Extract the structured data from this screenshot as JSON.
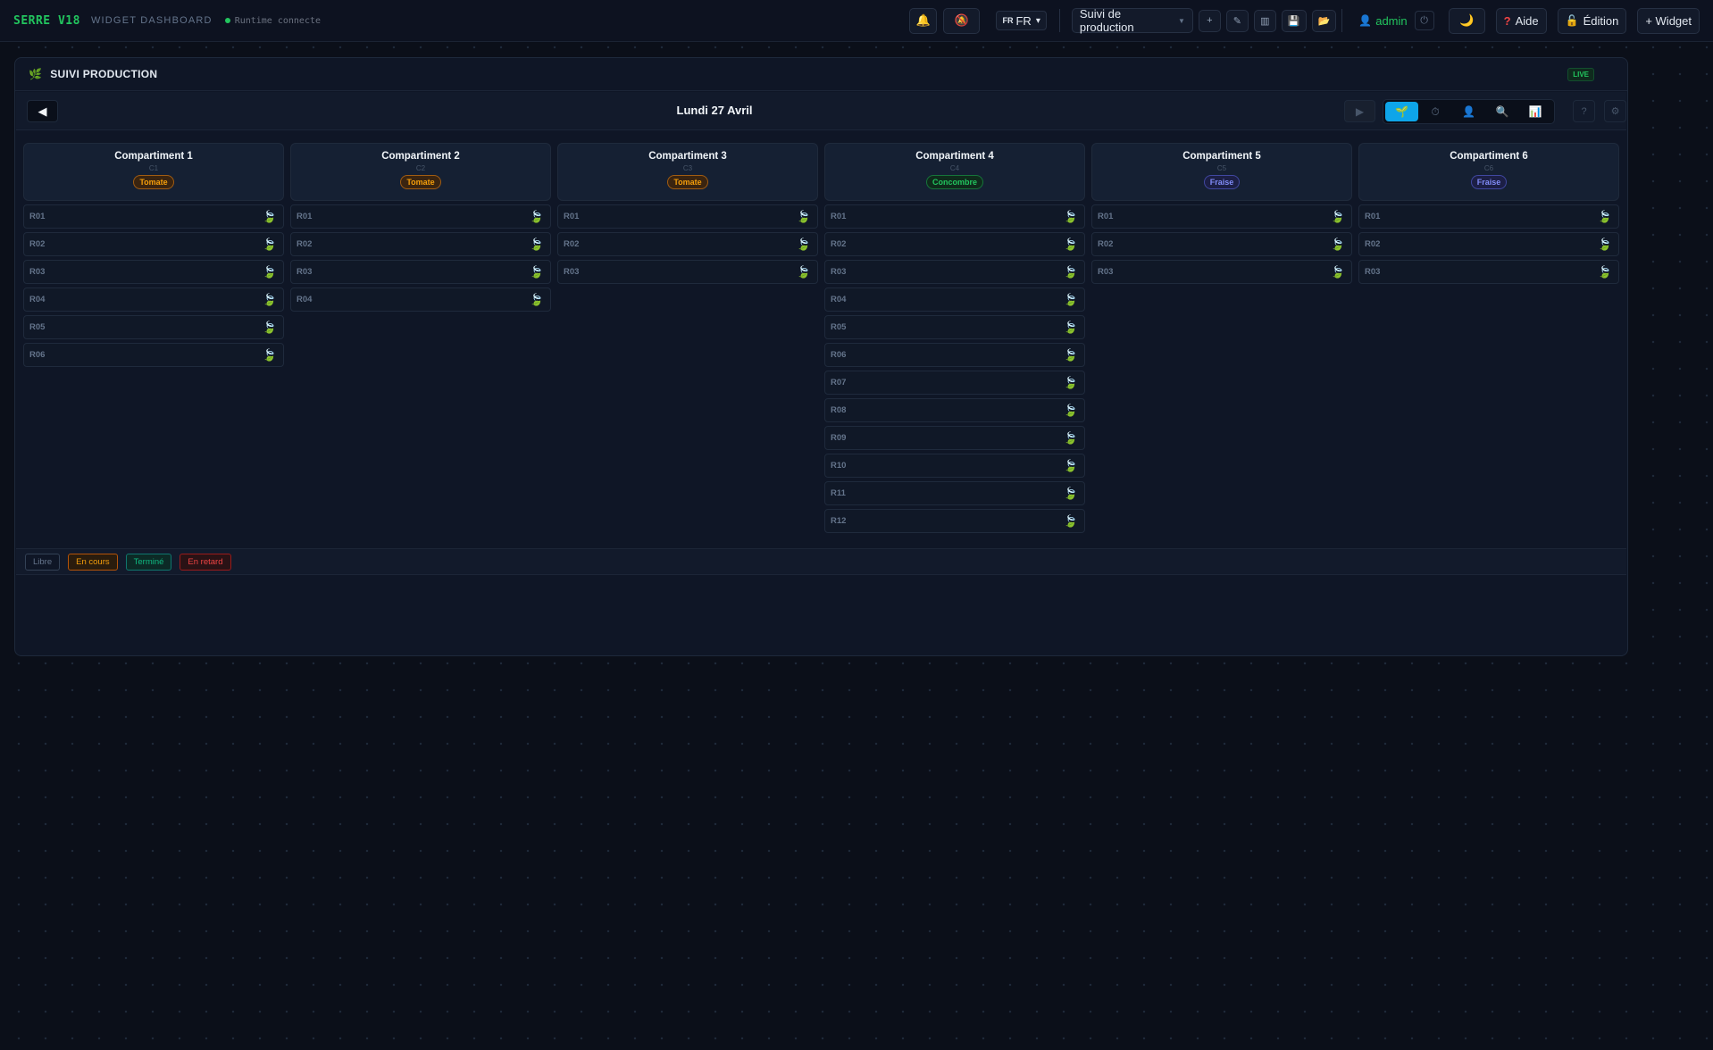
{
  "header": {
    "brand": "SERRE V18",
    "subtitle": "WIDGET DASHBOARD",
    "runtime_status": "Runtime connecte",
    "language": {
      "code": "FR",
      "label": "FR"
    },
    "view_select": "Suivi de production",
    "user": "admin",
    "help_label": "Aide",
    "edit_label": "Édition",
    "widget_label": "+ Widget"
  },
  "widget": {
    "title": "SUIVI PRODUCTION",
    "live_badge": "LIVE",
    "date": "Lundi 27 Avril",
    "view_modes": [
      "plant",
      "timer",
      "user",
      "search",
      "chart"
    ],
    "active_view_mode": "plant"
  },
  "compartments": [
    {
      "name": "Compartiment 1",
      "code": "C1",
      "crop": "Tomate",
      "rows": [
        "R01",
        "R02",
        "R03",
        "R04",
        "R05",
        "R06"
      ]
    },
    {
      "name": "Compartiment 2",
      "code": "C2",
      "crop": "Tomate",
      "rows": [
        "R01",
        "R02",
        "R03",
        "R04"
      ]
    },
    {
      "name": "Compartiment 3",
      "code": "C3",
      "crop": "Tomate",
      "rows": [
        "R01",
        "R02",
        "R03"
      ]
    },
    {
      "name": "Compartiment 4",
      "code": "C4",
      "crop": "Concombre",
      "rows": [
        "R01",
        "R02",
        "R03",
        "R04",
        "R05",
        "R06",
        "R07",
        "R08",
        "R09",
        "R10",
        "R11",
        "R12"
      ]
    },
    {
      "name": "Compartiment 5",
      "code": "C5",
      "crop": "Fraise",
      "rows": [
        "R01",
        "R02",
        "R03"
      ]
    },
    {
      "name": "Compartiment 6",
      "code": "C6",
      "crop": "Fraise",
      "rows": [
        "R01",
        "R02",
        "R03"
      ]
    }
  ],
  "legend": [
    "Libre",
    "En cours",
    "Terminé",
    "En retard"
  ],
  "colors": {
    "brand": "#22c55e",
    "tomate": "#f59e0b",
    "concombre": "#22c55e",
    "fraise": "#818cf8",
    "active_view": "#0ea5e9"
  }
}
